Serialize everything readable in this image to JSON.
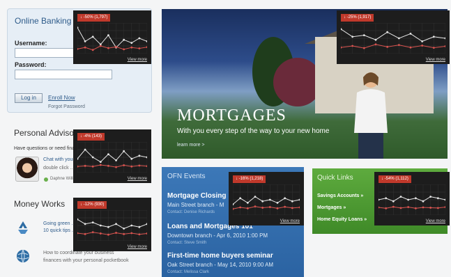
{
  "login": {
    "title": "Online Banking",
    "username_label": "Username:",
    "password_label": "Password:",
    "login_button": "Log in",
    "enroll_link": "Enroll Now",
    "forgot_link": "Forgot Password"
  },
  "advisor": {
    "title": "Personal Advisor",
    "question": "Have questions or need financial advice?",
    "chat": "Chat with your ...",
    "double": "double click ...",
    "name": "Daphne Williams"
  },
  "money": {
    "title": "Money Works",
    "item1_line1": "Going green ... 2010",
    "item1_line2": "10 quick tips ...",
    "item2_line1": "How to coordinate your business",
    "item2_line2": "finances with your personal pocketbook"
  },
  "hero": {
    "title": "MORTGAGES",
    "subtitle": "With you every step of the way to your new home",
    "more": "learn more >"
  },
  "events": {
    "title": "OFN Events",
    "items": [
      {
        "title": "Mortgage Closing",
        "sub": "Main Street branch - M",
        "contact": "Contact: Denise Richards"
      },
      {
        "title": "Loans and Mortgages 101",
        "sub": "Downtown branch - Apr 6, 2010 1:00 PM",
        "contact": "Contact: Steve Smith"
      },
      {
        "title": "First-time home buyers seminar",
        "sub": "Oak Street branch - May 14, 2010 9:00 AM",
        "contact": "Contact: Melissa Clark"
      }
    ]
  },
  "quick": {
    "title": "Quick Links",
    "items": [
      "Savings Accounts »",
      "Mortgages »",
      "Home Equity Loans »"
    ]
  },
  "overlays": [
    {
      "id": "login",
      "badge": "↓ -50% (1,797)",
      "view_more": "View more",
      "top": [
        0.85,
        0.4,
        0.55,
        0.3,
        0.6,
        0.2,
        0.45,
        0.35,
        0.5,
        0.4
      ],
      "bottom": [
        0.15,
        0.2,
        0.12,
        0.25,
        0.18,
        0.22,
        0.14,
        0.2,
        0.17,
        0.21
      ]
    },
    {
      "id": "hero",
      "badge": "↓ -25% (1,917)",
      "view_more": "View more",
      "top": [
        0.8,
        0.55,
        0.6,
        0.45,
        0.7,
        0.5,
        0.65,
        0.4,
        0.55,
        0.5
      ],
      "bottom": [
        0.2,
        0.25,
        0.18,
        0.3,
        0.22,
        0.28,
        0.2,
        0.26,
        0.19,
        0.24
      ]
    },
    {
      "id": "advisor",
      "badge": "↓ -4% (143)",
      "view_more": "View more",
      "top": [
        0.45,
        0.75,
        0.5,
        0.35,
        0.6,
        0.4,
        0.7,
        0.45,
        0.55,
        0.5
      ],
      "bottom": [
        0.2,
        0.22,
        0.2,
        0.25,
        0.22,
        0.18,
        0.24,
        0.2,
        0.23,
        0.21
      ]
    },
    {
      "id": "events",
      "badge": "↓ -16% (1,218)",
      "view_more": "View more",
      "top": [
        0.35,
        0.55,
        0.4,
        0.6,
        0.45,
        0.5,
        0.4,
        0.55,
        0.45,
        0.5
      ],
      "bottom": [
        0.2,
        0.25,
        0.22,
        0.28,
        0.24,
        0.26,
        0.22,
        0.27,
        0.23,
        0.25
      ]
    },
    {
      "id": "money",
      "badge": "↓ -12% (930)",
      "view_more": "View more",
      "top": [
        0.7,
        0.55,
        0.6,
        0.5,
        0.45,
        0.55,
        0.4,
        0.5,
        0.45,
        0.55
      ],
      "bottom": [
        0.25,
        0.22,
        0.28,
        0.24,
        0.2,
        0.26,
        0.22,
        0.25,
        0.21,
        0.24
      ]
    },
    {
      "id": "quick",
      "badge": "↓ -54% (1,112)",
      "view_more": "View more",
      "top": [
        0.5,
        0.55,
        0.45,
        0.6,
        0.5,
        0.55,
        0.45,
        0.6,
        0.55,
        0.5
      ],
      "bottom": [
        0.25,
        0.22,
        0.27,
        0.23,
        0.26,
        0.22,
        0.25,
        0.24,
        0.23,
        0.26
      ]
    }
  ],
  "colors": {
    "overlay_bg": "#1d1d1d",
    "line_top": "#e6e6e6",
    "line_bottom": "#d9534f",
    "badge": "#c0392b"
  }
}
